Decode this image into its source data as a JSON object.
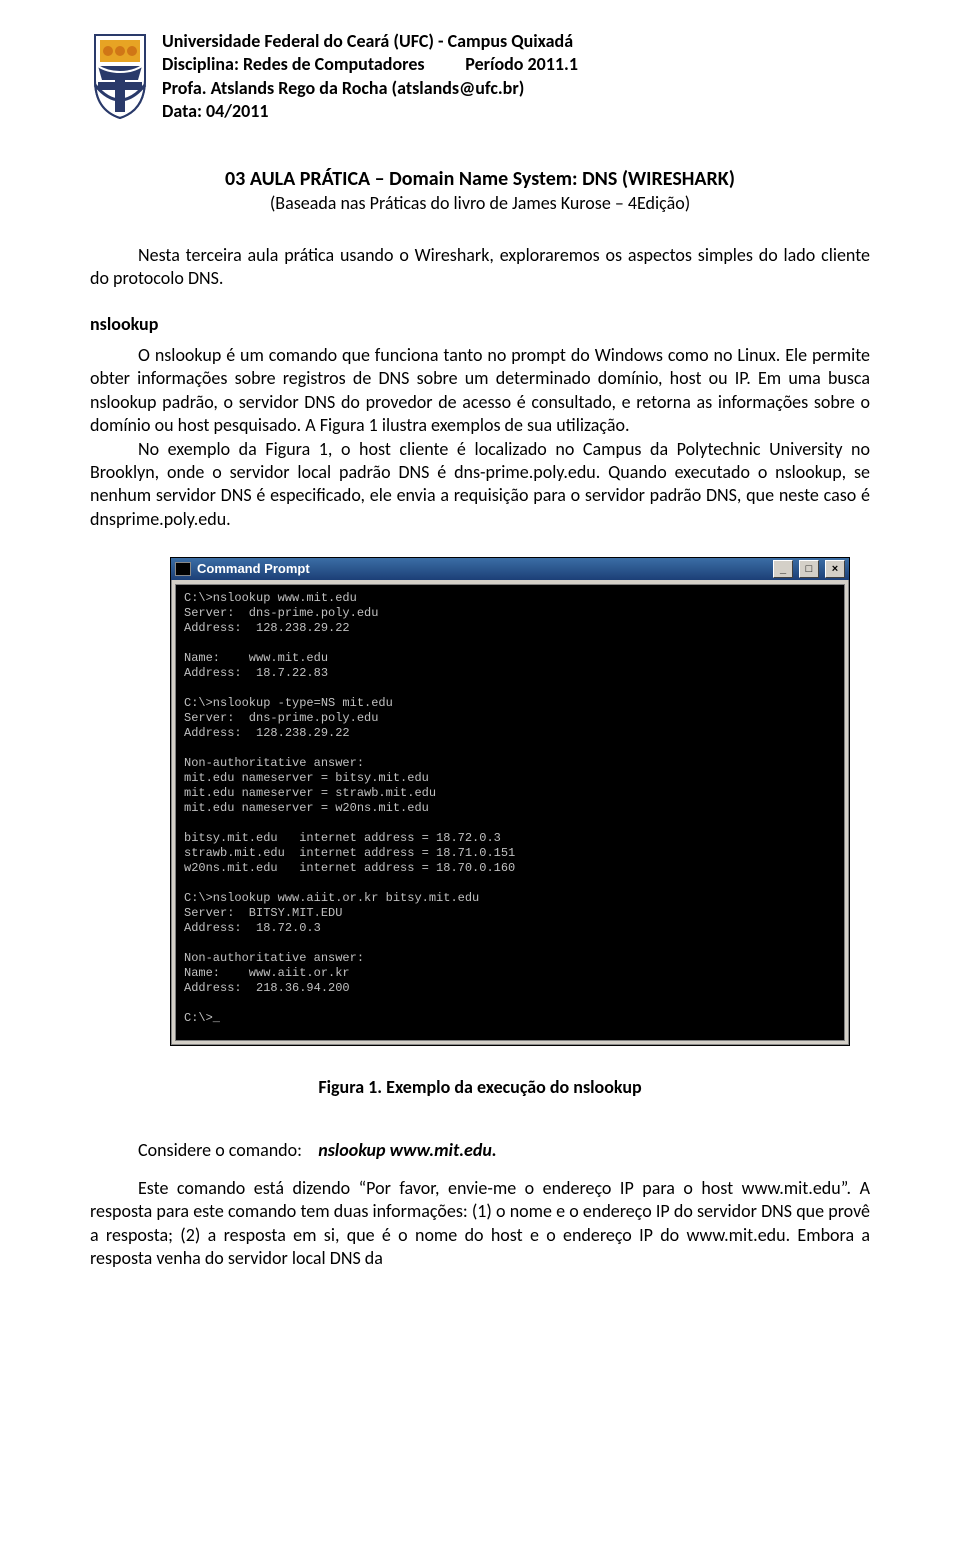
{
  "header": {
    "line1": "Universidade Federal do Ceará  (UFC) - Campus Quixadá",
    "line2a": "Disciplina: Redes de Computadores",
    "line2b": "Período 2011.1",
    "line3": "Profa. Atslands Rego da Rocha    (atslands@ufc.br)",
    "line4": "Data:  04/2011"
  },
  "title": {
    "main": "03 AULA PRÁTICA – Domain Name System: DNS  (WIRESHARK)",
    "sub": "(Baseada nas Práticas do livro de James Kurose – 4Edição)"
  },
  "intro": "Nesta terceira aula prática usando o Wireshark, exploraremos os aspectos simples do lado cliente do protocolo DNS.",
  "section1": "nslookup",
  "para1": "O nslookup é um comando que funciona tanto no prompt do Windows como no Linux. Ele permite obter informações sobre registros de DNS sobre um determinado domínio, host ou IP. Em uma busca nslookup padrão, o servidor DNS do provedor de acesso é consultado, e retorna as informações sobre o domínio ou host pesquisado. A Figura 1 ilustra exemplos de sua utilização.",
  "para2": "No exemplo da Figura 1, o host cliente é localizado no Campus da Polytechnic University no Brooklyn, onde o servidor local padrão DNS é dns-prime.poly.edu. Quando executado o nslookup, se nenhum servidor DNS é especificado, ele envia a requisição para o servidor padrão DNS, que neste caso é dnsprime.poly.edu.",
  "cmd": {
    "title": "Command Prompt",
    "min": "_",
    "max": "□",
    "close": "×",
    "content": "C:\\>nslookup www.mit.edu\nServer:  dns-prime.poly.edu\nAddress:  128.238.29.22\n\nName:    www.mit.edu\nAddress:  18.7.22.83\n\nC:\\>nslookup -type=NS mit.edu\nServer:  dns-prime.poly.edu\nAddress:  128.238.29.22\n\nNon-authoritative answer:\nmit.edu nameserver = bitsy.mit.edu\nmit.edu nameserver = strawb.mit.edu\nmit.edu nameserver = w20ns.mit.edu\n\nbitsy.mit.edu   internet address = 18.72.0.3\nstrawb.mit.edu  internet address = 18.71.0.151\nw20ns.mit.edu   internet address = 18.70.0.160\n\nC:\\>nslookup www.aiit.or.kr bitsy.mit.edu\nServer:  BITSY.MIT.EDU\nAddress:  18.72.0.3\n\nNon-authoritative answer:\nName:    www.aiit.or.kr\nAddress:  218.36.94.200\n\nC:\\>_"
  },
  "fig_caption": "Figura 1. Exemplo da execução do nslookup",
  "consider_label": "Considere o comando:",
  "consider_cmd": "nslookup www.mit.edu.",
  "para3": "Este comando está dizendo “Por favor, envie-me o endereço IP para o host www.mit.edu”.  A resposta para este comando tem duas informações: (1) o nome e o endereço IP do servidor DNS que provê a resposta;  (2) a resposta em si, que é o nome do host e o endereço IP do www.mit.edu. Embora a resposta venha do servidor local DNS da"
}
